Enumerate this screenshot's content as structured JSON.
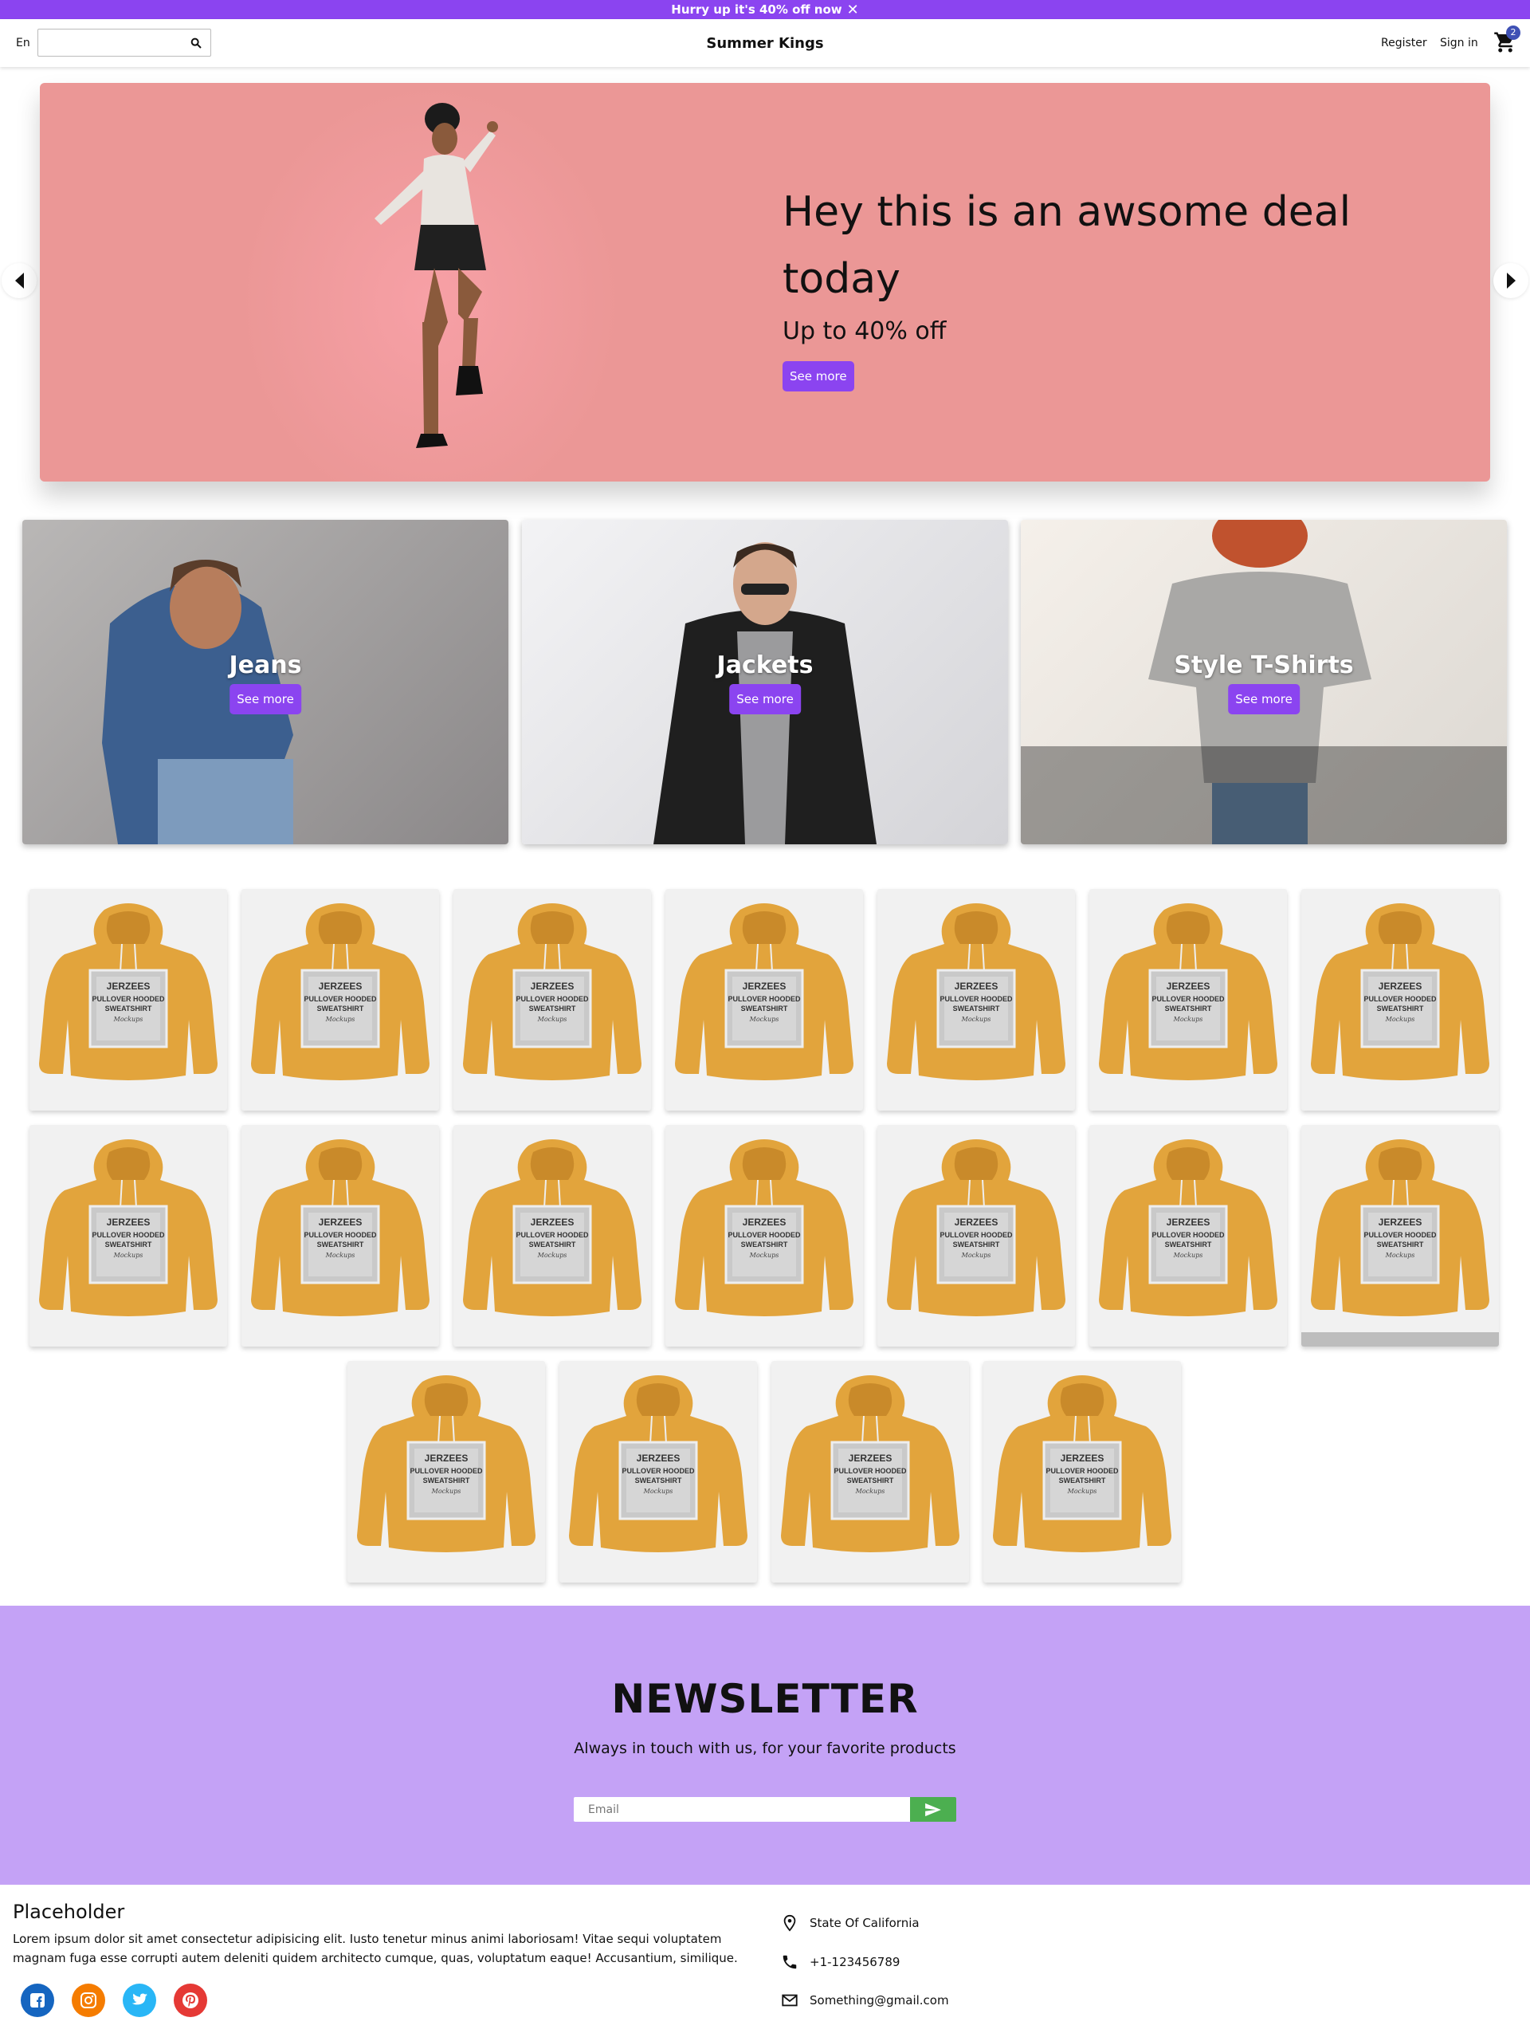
{
  "promo": {
    "text": "Hurry up it's 40% off now",
    "close": "✕"
  },
  "nav": {
    "language": "En",
    "search_placeholder": "",
    "brand": "Summer Kings",
    "register": "Register",
    "signin": "Sign in",
    "cart_count": "2"
  },
  "hero": {
    "title": "Hey this is an awsome deal today",
    "subtitle": "Up to 40% off",
    "button": "See more"
  },
  "categories": [
    {
      "title": "Jeans",
      "button": "See more"
    },
    {
      "title": "Jackets",
      "button": "See more"
    },
    {
      "title": "Style T-Shirts",
      "button": "See more"
    }
  ],
  "products": {
    "count": 18,
    "image_caption": [
      "JERZEES",
      "PULLOVER HOODED",
      "SWEATSHIRT",
      "Mockups"
    ]
  },
  "newsletter": {
    "title": "NEWSLETTER",
    "description": "Always in touch with us, for your favorite products",
    "email_placeholder": "Email"
  },
  "footer": {
    "title": "Placeholder",
    "description": "Lorem ipsum dolor sit amet consectetur adipisicing elit. Iusto tenetur minus animi laboriosam! Vitae sequi voluptatem magnam fuga esse corrupti autem deleniti quidem architecto cumque, quas, voluptatum eaque! Accusantium, similique.",
    "address": "State Of California",
    "phone": "+1-123456789",
    "email": "Something@gmail.com"
  },
  "colors": {
    "accent": "#8b44f0",
    "hero_bg": "#eb9796",
    "newsletter_bg": "#c4a2f6",
    "send_button": "#4caf50",
    "hoodie": "#e2a43c",
    "facebook": "#1565c0",
    "instagram": "#f57c00",
    "twitter": "#29b6f6",
    "pinterest": "#e53935"
  }
}
